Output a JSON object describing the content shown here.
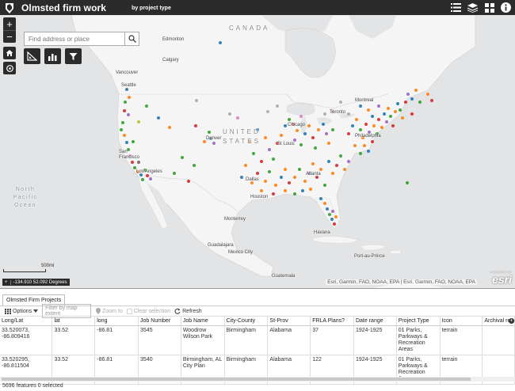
{
  "header": {
    "title": "Olmsted firm work",
    "subtitle": "by project type"
  },
  "map": {
    "search_placeholder": "Find address or place",
    "labels": {
      "canada": "CANADA",
      "united_states": "UNITED STATES",
      "north_pacific_ocean": "North Pacific Ocean",
      "edmonton": "Edmonton",
      "calgary": "Calgary",
      "vancouver": "Vancouver",
      "seattle": "Seattle",
      "san_francisco": "San Francisco",
      "los_angeles": "Los Angeles",
      "denver": "Denver",
      "chicago": "Chicago",
      "toronto": "Toronto",
      "montreal": "Montreal",
      "st_louis": "St Louis",
      "dallas": "Dallas",
      "houston": "Houston",
      "atlanta": "Atlanta",
      "philadelphia": "Philadelphia",
      "monterrey": "Monterrey",
      "guadalajara": "Guadalajara",
      "mexico_city": "Mexico City",
      "havana": "Havana",
      "port_au_prince": "Port-au-Prince",
      "guatemala": "Guatemala"
    },
    "scale_label": "500mi",
    "coordinates": "-134.910 52.092 Degrees",
    "attribution": "Esri, Garmin, FAO, NOAA, EPA | Esri, Garmin, FAO, NOAA, EPA",
    "esri_logo": "esri",
    "powered_by": "POWERED BY"
  },
  "panel": {
    "tab_label": "Olmsted Firm Projects",
    "toolbar": {
      "options": "Options",
      "filter_placeholder": "Filter by map extent",
      "zoom_to": "Zoom to",
      "clear_selection": "Clear selection",
      "refresh": "Refresh"
    },
    "columns": [
      "Long/Lat",
      "lat",
      "long",
      "Job Number",
      "Job Name",
      "City-County",
      "St-Prov",
      "FRLA Plans?",
      "Date range",
      "Project Type",
      "Icon",
      "Archival records"
    ],
    "rows": [
      [
        "33.520073, -86.809416",
        "33.52",
        "-86.81",
        "3545",
        "Woodrow Wilson Park",
        "Birmingham",
        "Alabama",
        "37",
        "1924-1925",
        "01 Parks, Parkways & Recreation Areas",
        "terrain",
        ""
      ],
      [
        "33.520295, -86.811504",
        "33.52",
        "-86.81",
        "3540",
        "Birmingham, AL City Plan",
        "Birmingham",
        "Alabama",
        "122",
        "1924-1925",
        "01 Parks, Parkways & Recreation Areas",
        "terrain",
        ""
      ]
    ],
    "footer": "5696 features 0 selected"
  }
}
